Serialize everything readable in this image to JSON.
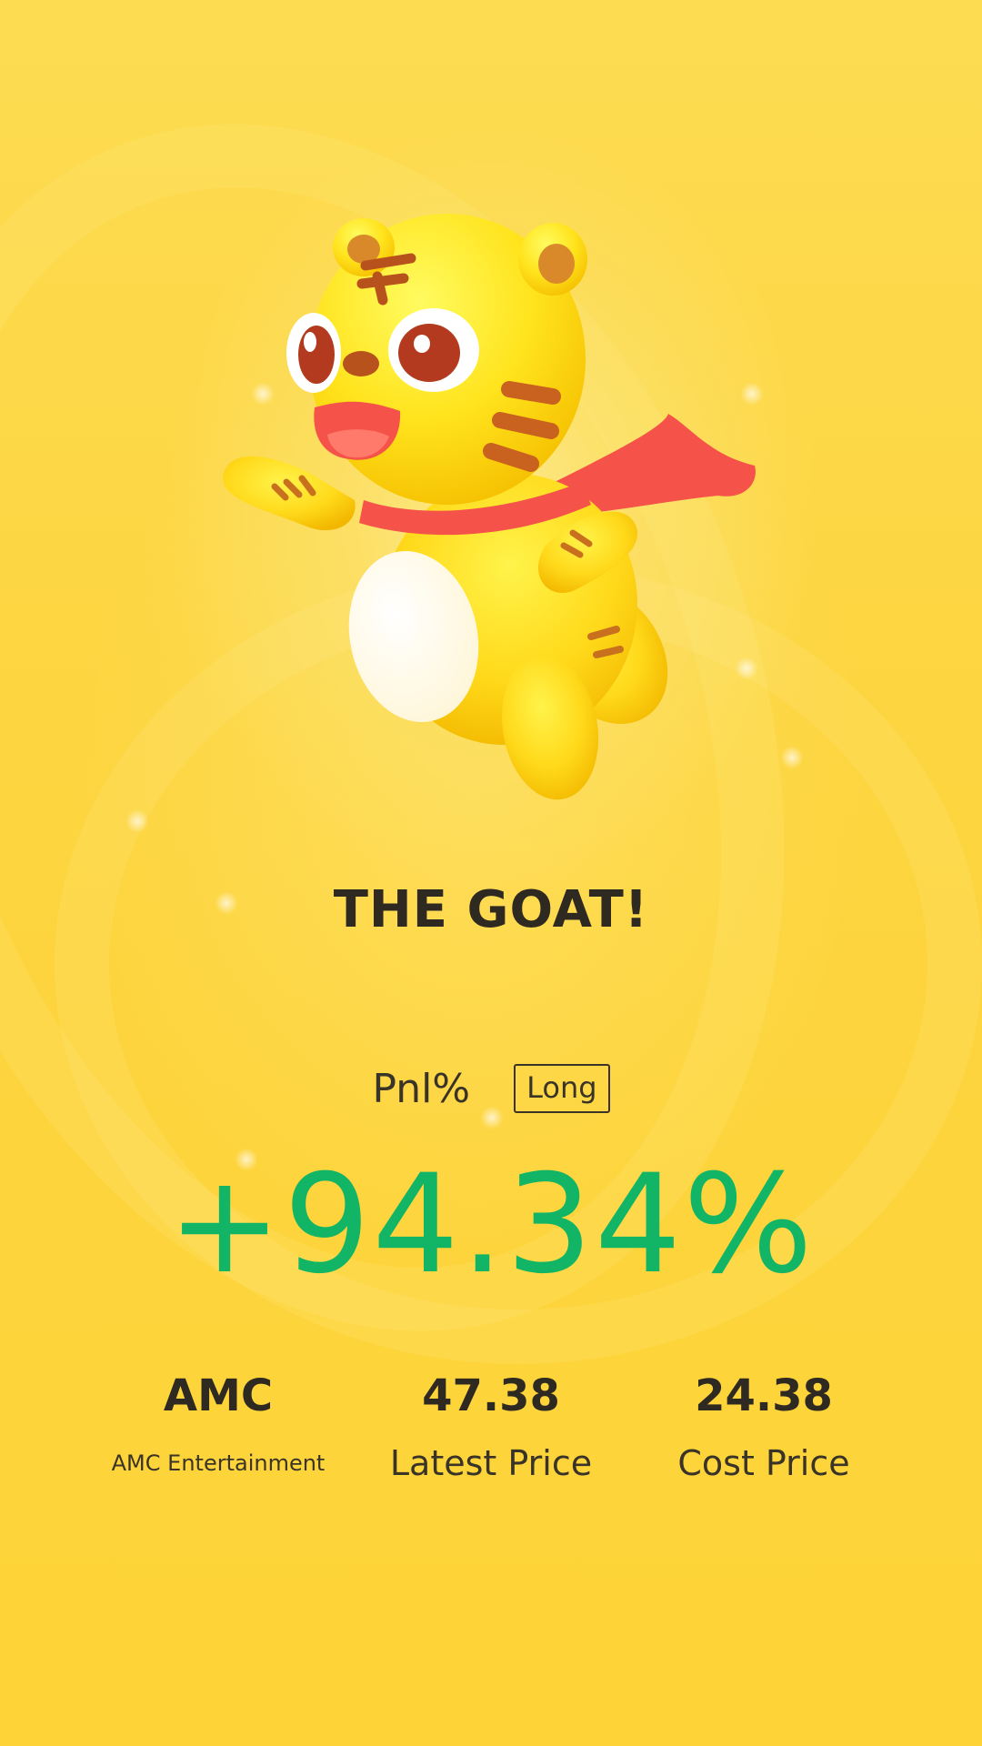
{
  "headline": "THE GOAT!",
  "pnl": {
    "label": "Pnl%",
    "direction": "Long",
    "value": "+94.34%"
  },
  "stats": [
    {
      "value": "AMC",
      "label": "AMC Entertainment"
    },
    {
      "value": "47.38",
      "label": "Latest Price"
    },
    {
      "value": "24.38",
      "label": "Cost Price"
    }
  ],
  "colors": {
    "background": "#fdd540",
    "profit": "#12b565",
    "text": "#2e2a22",
    "scarf": "#f5524a"
  },
  "mascot": "tiger-mascot-icon"
}
